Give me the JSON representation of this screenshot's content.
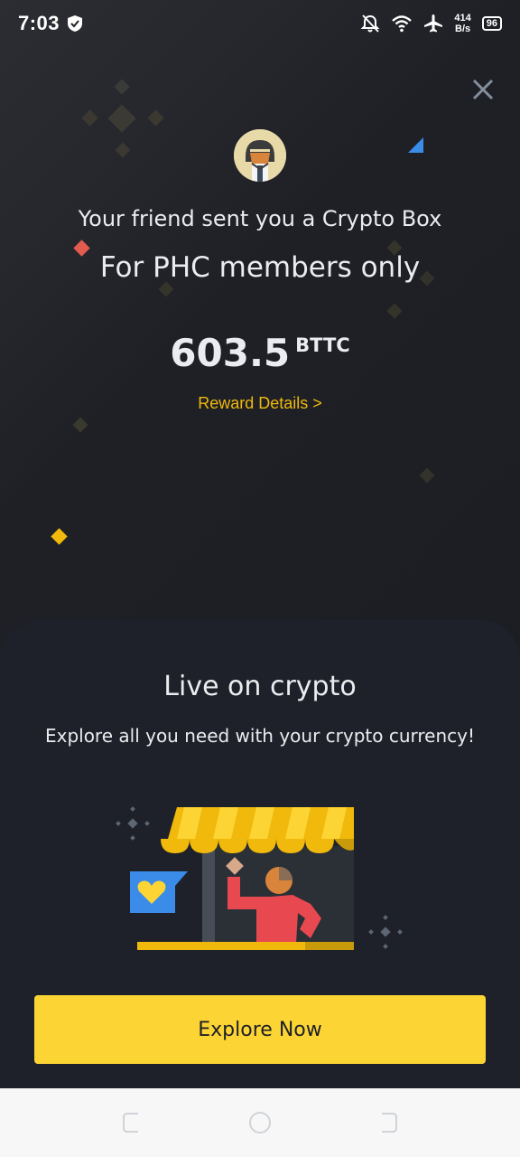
{
  "status_bar": {
    "time": "7:03",
    "net_speed_value": "414",
    "net_speed_unit": "B/s",
    "battery": "96",
    "icons": [
      "shield-icon",
      "mute-icon",
      "wifi-icon",
      "airplane-icon",
      "battery-icon"
    ]
  },
  "crypto_box": {
    "friend_message": "Your friend sent you a Crypto Box",
    "restriction": "For PHC members only",
    "amount": "603.5",
    "currency": "BTTC",
    "reward_details_link": "Reward Details >"
  },
  "promo_card": {
    "title": "Live on crypto",
    "subtitle": "Explore all you need with your crypto currency!",
    "illustration": "crypto-shop-illustration"
  },
  "cta": {
    "label": "Explore Now"
  },
  "colors": {
    "accent": "#fcd535",
    "link": "#f0b90b",
    "background": "#1e2026"
  }
}
